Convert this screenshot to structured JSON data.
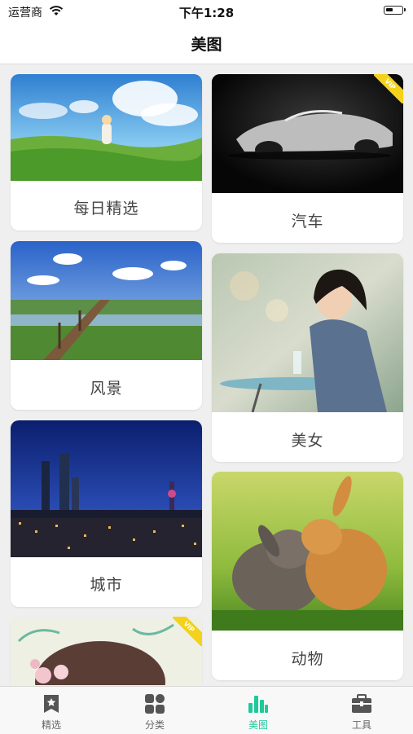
{
  "status_bar": {
    "carrier": "运营商",
    "time": "下午1:28"
  },
  "nav": {
    "title": "美图"
  },
  "categories": [
    {
      "label": "每日精选",
      "vip": false
    },
    {
      "label": "汽车",
      "vip": true,
      "badge": "VIP"
    },
    {
      "label": "风景",
      "vip": false
    },
    {
      "label": "美女",
      "vip": false
    },
    {
      "label": "城市",
      "vip": false
    },
    {
      "label": "动物",
      "vip": false
    },
    {
      "label": "",
      "vip": true,
      "badge": "VIP"
    }
  ],
  "tabs": [
    {
      "label": "精选",
      "icon": "star-card-icon",
      "active": false
    },
    {
      "label": "分类",
      "icon": "grid-icon",
      "active": false
    },
    {
      "label": "美图",
      "icon": "bar-chart-icon",
      "active": true
    },
    {
      "label": "工具",
      "icon": "toolbox-icon",
      "active": false
    }
  ],
  "colors": {
    "accent": "#1fc99a",
    "vip_badge": "#f4d21b",
    "background": "#efefef"
  }
}
